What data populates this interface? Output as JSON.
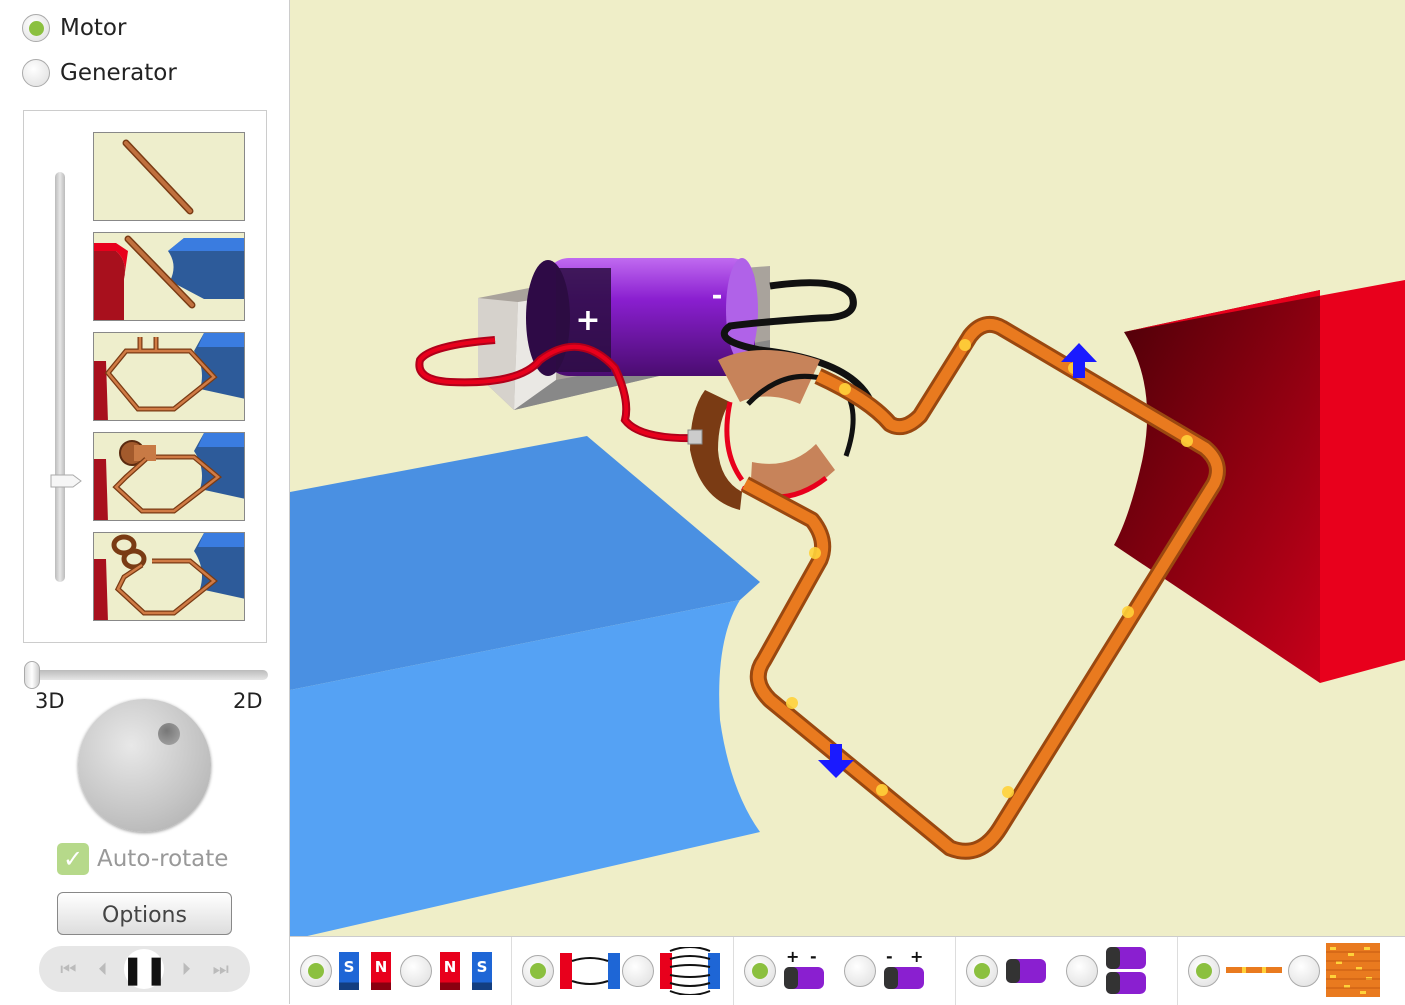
{
  "mode": {
    "options": [
      {
        "label": "Motor",
        "selected": true
      },
      {
        "label": "Generator",
        "selected": false
      }
    ]
  },
  "build_steps": [
    "straight-wire",
    "wire-between-magnets",
    "square-loop",
    "loop-with-split-ring",
    "loop-with-slip-rings"
  ],
  "build_step_selected_index": 3,
  "view": {
    "label_3d": "3D",
    "label_2d": "2D",
    "value": 0
  },
  "autorotate": {
    "label": "Auto-rotate",
    "checked": true
  },
  "options_button": "Options",
  "playback": {
    "state": "paused"
  },
  "toolbar": {
    "magnets": {
      "options": [
        "S-N",
        "N-S"
      ],
      "selected": 0,
      "labels": [
        "S",
        "N",
        "N",
        "S"
      ]
    },
    "field": {
      "options": [
        "magnet-pair",
        "field-lines"
      ],
      "selected": 0
    },
    "battery_polarity": {
      "options": [
        "+ -",
        "- +"
      ],
      "selected": 0,
      "labels": [
        "+",
        "-",
        "-",
        "+"
      ]
    },
    "battery_count": {
      "options": [
        "one-battery",
        "two-batteries"
      ],
      "selected": 0
    },
    "wire_view": {
      "options": [
        "wire",
        "wire-bundle"
      ],
      "selected": 0
    }
  },
  "scene": {
    "battery_labels": {
      "positive": "+",
      "negative": "-"
    },
    "current_markers": 9,
    "force_arrows": [
      "up",
      "down"
    ]
  },
  "colors": {
    "accent": "#8bc03f",
    "scene_bg": "#efeec8",
    "north": "#e8001c",
    "south": "#4a90e2",
    "wire": "#e97a1f",
    "arrow": "#1a1aff",
    "battery": "#8a1fd0"
  }
}
